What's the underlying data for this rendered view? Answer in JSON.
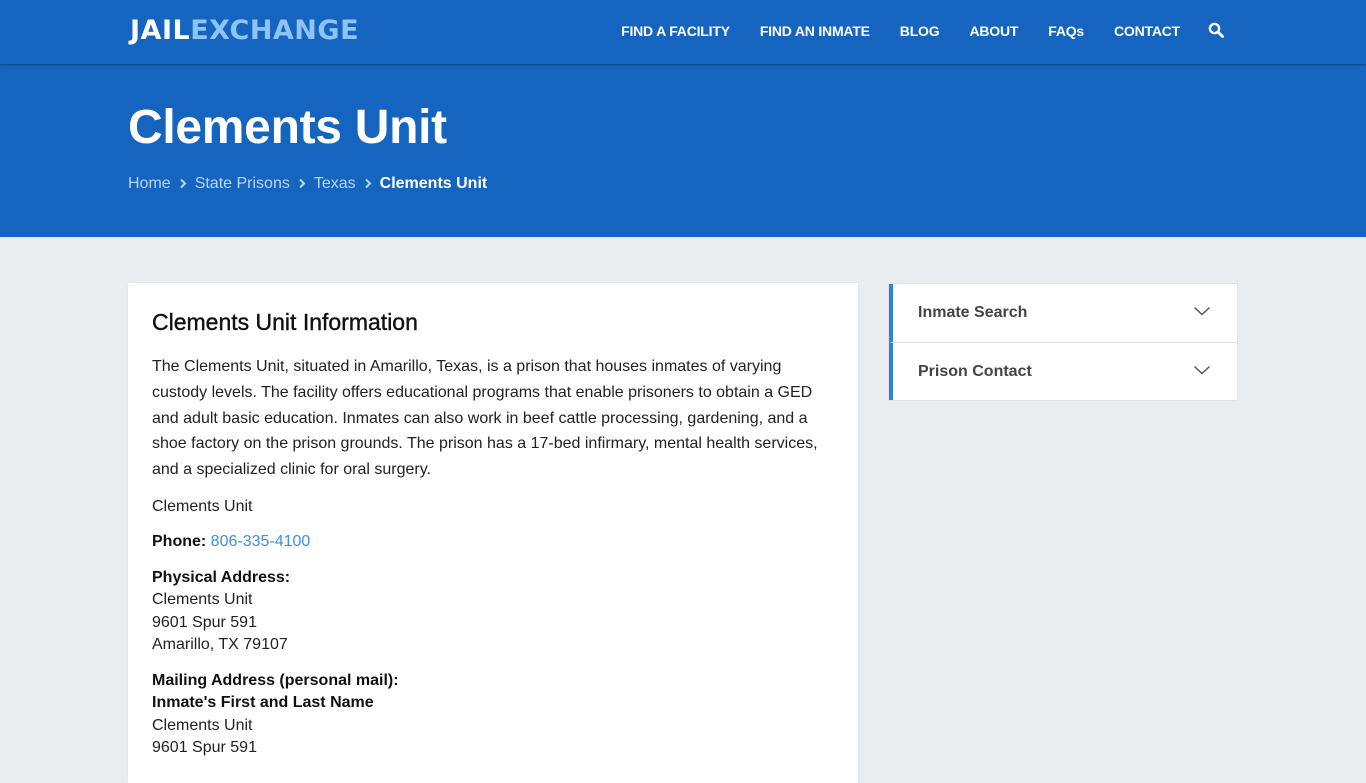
{
  "header": {
    "logo": {
      "part1": "JAIL",
      "part2": "EXCHANGE"
    },
    "nav": [
      {
        "label": "FIND A FACILITY"
      },
      {
        "label": "FIND AN INMATE"
      },
      {
        "label": "BLOG"
      },
      {
        "label": "ABOUT"
      },
      {
        "label": "FAQs"
      },
      {
        "label": "CONTACT"
      }
    ],
    "search_icon": "search-icon"
  },
  "hero": {
    "title": "Clements Unit",
    "breadcrumb": [
      {
        "label": "Home"
      },
      {
        "label": "State Prisons"
      },
      {
        "label": "Texas"
      },
      {
        "label": "Clements Unit"
      }
    ]
  },
  "main": {
    "heading": "Clements Unit Information",
    "description": "The Clements Unit, situated in Amarillo, Texas, is a prison that houses inmates of varying custody levels. The facility offers educational programs that enable prisoners to obtain a GED and adult basic education. Inmates can also work in beef cattle processing, gardening, and a shoe factory on the prison grounds. The prison has a 17-bed infirmary, mental health services, and a specialized clinic for oral surgery.",
    "facility_name": "Clements Unit",
    "phone": {
      "label": "Phone:",
      "value": "806-335-4100"
    },
    "physical_address": {
      "label": "Physical Address:",
      "lines": [
        "Clements Unit",
        "9601 Spur 591",
        "Amarillo, TX 79107"
      ]
    },
    "mailing_address": {
      "label": "Mailing Address (personal mail):",
      "name_line": "Inmate's First and Last Name",
      "lines": [
        "Clements Unit",
        "9601 Spur 591"
      ]
    }
  },
  "sidebar": {
    "accordion": [
      {
        "label": "Inmate Search",
        "icon": "chevron-down-icon"
      },
      {
        "label": "Prison Contact",
        "icon": "chevron-down-icon"
      }
    ]
  },
  "colors": {
    "brand_blue": "#1565c0",
    "logo_accent": "#8ec3f4",
    "link_blue": "#3d8fe0",
    "accordion_accent": "#2a86d9",
    "page_bg": "#e9edf0"
  }
}
